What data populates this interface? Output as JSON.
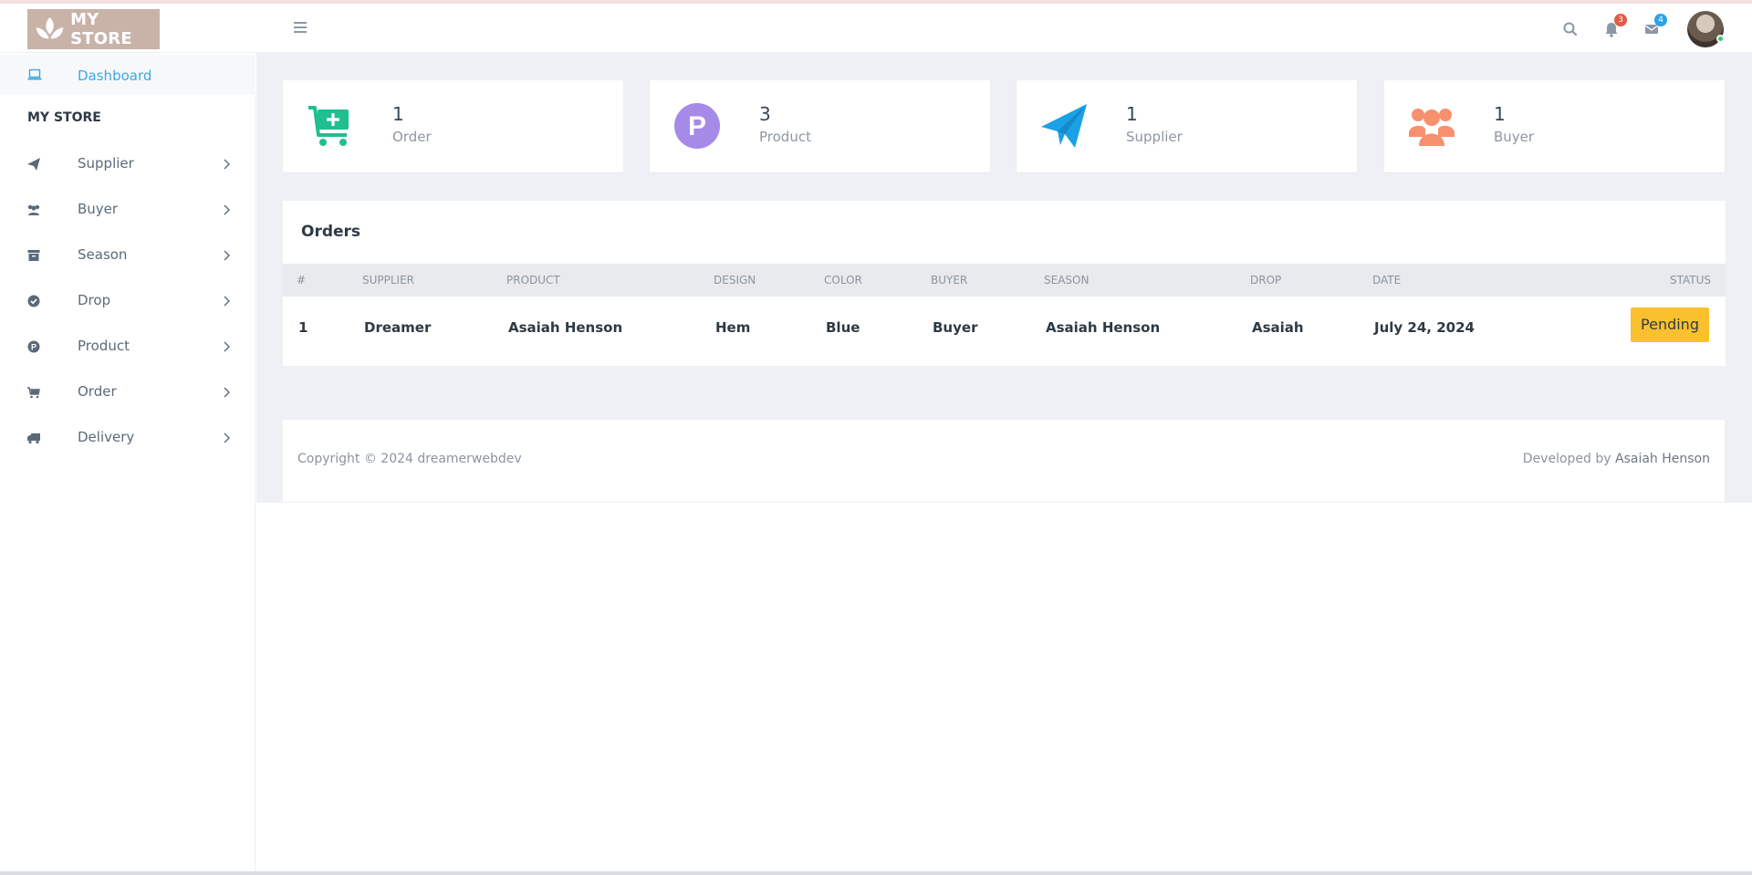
{
  "brand": {
    "name": "MY STORE",
    "logo_color": "#c9b3a9"
  },
  "header": {
    "notifications": {
      "icon": "bell-icon",
      "count": "3",
      "badge_color": "#e25b45"
    },
    "messages": {
      "icon": "envelope-icon",
      "count": "4",
      "badge_color": "#2aa3e6"
    },
    "search_icon": "search-icon"
  },
  "sidebar": {
    "dashboard_label": "Dashboard",
    "section_title": "MY STORE",
    "items": [
      {
        "label": "Supplier",
        "icon": "paper-plane-icon"
      },
      {
        "label": "Buyer",
        "icon": "users-icon"
      },
      {
        "label": "Season",
        "icon": "archive-icon"
      },
      {
        "label": "Drop",
        "icon": "check-circle-icon"
      },
      {
        "label": "Product",
        "icon": "product-p-icon"
      },
      {
        "label": "Order",
        "icon": "cart-icon"
      },
      {
        "label": "Delivery",
        "icon": "truck-icon"
      }
    ]
  },
  "stats": [
    {
      "value": "1",
      "label": "Order",
      "icon": "cart-plus-icon",
      "color": "#1fbf8f"
    },
    {
      "value": "3",
      "label": "Product",
      "icon": "product-p-icon",
      "color": "#a58ae8"
    },
    {
      "value": "1",
      "label": "Supplier",
      "icon": "paper-plane-icon",
      "color": "#1aa1e6"
    },
    {
      "value": "1",
      "label": "Buyer",
      "icon": "users-icon",
      "color": "#f7906d"
    }
  ],
  "orders": {
    "title": "Orders",
    "columns": [
      "#",
      "SUPPLIER",
      "PRODUCT",
      "DESIGN",
      "COLOR",
      "BUYER",
      "SEASON",
      "DROP",
      "DATE",
      "STATUS"
    ],
    "rows": [
      {
        "num": "1",
        "supplier": "Dreamer",
        "product": "Asaiah Henson",
        "design": "Hem",
        "color": "Blue",
        "buyer": "Buyer",
        "season": "Asaiah Henson",
        "drop": "Asaiah",
        "date": "July 24, 2024",
        "status": "Pending"
      }
    ]
  },
  "footer": {
    "copyright": "Copyright © 2024 dreamerwebdev",
    "developed_prefix": "Developed by",
    "developer": "Asaiah Henson"
  }
}
